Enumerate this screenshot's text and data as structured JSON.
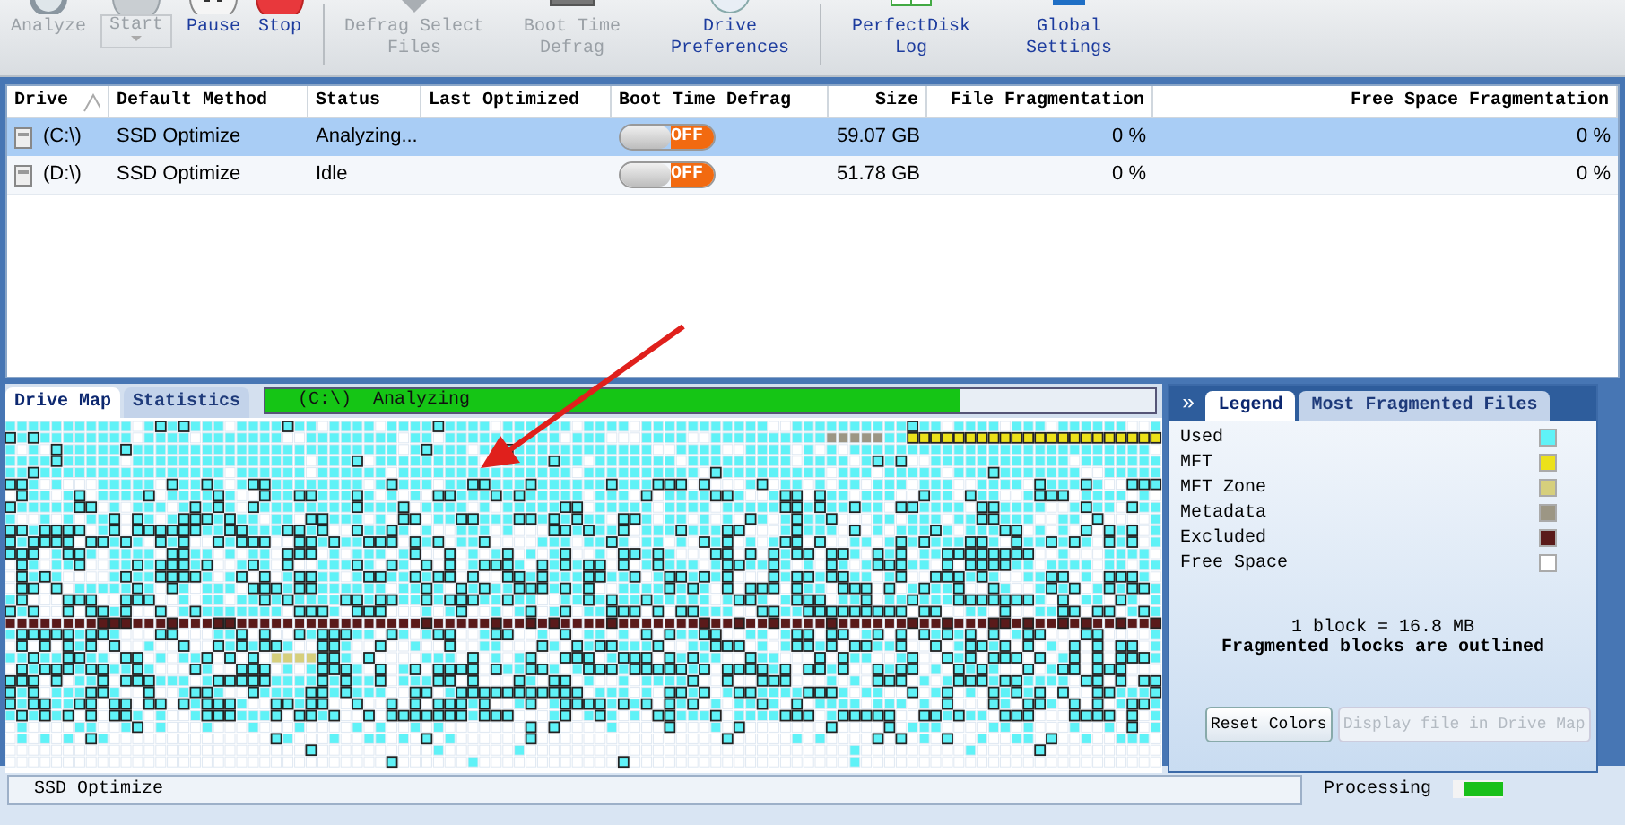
{
  "toolbar": {
    "buttons": [
      {
        "label": "Analyze",
        "disabled": true
      },
      {
        "label": "Start",
        "disabled": true,
        "dropdown": true
      },
      {
        "label": "Pause",
        "disabled": false
      },
      {
        "label": "Stop",
        "disabled": false,
        "separator_after": true
      },
      {
        "label": "Defrag Select Files",
        "disabled": true
      },
      {
        "label": "Boot Time Defrag",
        "disabled": true
      },
      {
        "label": "Drive Preferences",
        "disabled": false,
        "separator_after": true
      },
      {
        "label": "PerfectDisk Log",
        "disabled": false
      },
      {
        "label": "Global Settings",
        "disabled": false
      }
    ]
  },
  "table": {
    "columns": [
      {
        "label": "Drive"
      },
      {
        "label": "Default Method"
      },
      {
        "label": "Status"
      },
      {
        "label": "Last Optimized"
      },
      {
        "label": "Boot Time Defrag"
      },
      {
        "label": "Size"
      },
      {
        "label": "File Fragmentation"
      },
      {
        "label": "Free Space Fragmentation"
      }
    ],
    "rows": [
      {
        "drive": "(C:\\)",
        "method": "SSD Optimize",
        "status": "Analyzing...",
        "boot_time_defrag": {
          "on": false,
          "label": "OFF"
        },
        "size": "59.07 GB",
        "file_fragmentation": "0 %",
        "free_space_fragmentation": "0 %",
        "selected": true
      },
      {
        "drive": "(D:\\)",
        "method": "SSD Optimize",
        "status": "Idle",
        "boot_time_defrag": {
          "on": false,
          "label": "OFF"
        },
        "size": "51.78 GB",
        "file_fragmentation": "0 %",
        "free_space_fragmentation": "0 %",
        "selected": false
      }
    ]
  },
  "map_tabs": [
    {
      "label": "Drive Map",
      "selected": true
    },
    {
      "label": "Statistics",
      "selected": false
    }
  ],
  "progress": {
    "text": "(C:\\)  Analyzing",
    "level": 0.78
  },
  "legend": {
    "expand_icon": "»",
    "tabs": [
      {
        "label": "Legend",
        "selected": true
      },
      {
        "label": "Most Fragmented Files",
        "selected": false
      }
    ],
    "items": [
      {
        "label": "Used",
        "color": "#5ff2f7"
      },
      {
        "label": "MFT",
        "color": "#ece11a"
      },
      {
        "label": "MFT Zone",
        "color": "#d6cf7c"
      },
      {
        "label": "Metadata",
        "color": "#9c9684"
      },
      {
        "label": "Excluded",
        "color": "#5a1a1a"
      },
      {
        "label": "Free Space",
        "color": "#ffffff"
      }
    ],
    "block_size": "1 block = 16.8 MB",
    "note": "Fragmented blocks are outlined",
    "buttons": [
      {
        "label": "Reset Colors",
        "disabled": false
      },
      {
        "label": "Display file in Drive Map",
        "disabled": true
      }
    ]
  },
  "status_bar": {
    "method": "SSD Optimize",
    "state": "Processing"
  }
}
